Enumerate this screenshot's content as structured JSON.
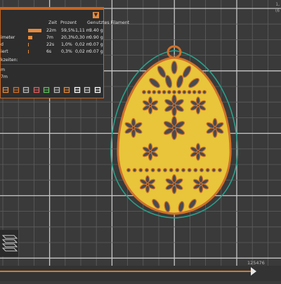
{
  "table": {
    "headers": {
      "time": "Zeit",
      "percent": "Prozent",
      "filament": "Genutztes Filament"
    },
    "rows": [
      {
        "label": "",
        "time": "22m",
        "percent": "59,5%",
        "fraction": 0.595,
        "length": "1,11 m",
        "weight": "3.40 g",
        "color": "#e58a3c"
      },
      {
        "label": "imeter",
        "time": "7m",
        "percent": "20,3%",
        "fraction": 0.203,
        "length": "0,30 m",
        "weight": "0.90 g",
        "color": "#e58a3c"
      },
      {
        "label": "d",
        "time": "22s",
        "percent": "1,0%",
        "fraction": 0.01,
        "length": "0,02 m",
        "weight": "0.07 g",
        "color": "#e58a3c"
      },
      {
        "label": "iert",
        "time": "6s",
        "percent": "0,3%",
        "fraction": 0.003,
        "length": "0,02 m",
        "weight": "0.07 g",
        "color": "#e58a3c"
      }
    ],
    "section_label": "kzeiten:",
    "time_rows": [
      "m",
      "7m"
    ]
  },
  "slider": {
    "value": "125476",
    "fraction": 0.91
  },
  "corner": {
    "line1": "1,",
    "line2": "(6"
  },
  "colors": {
    "accent": "#e58a3c",
    "panel_border": "#c9651f",
    "bed_background": "#3a3a3a",
    "grid": "#5e5e5e",
    "egg_fill": "#e8c53a",
    "egg_outline": "#d0702a",
    "egg_holes": "#4a4a4e",
    "skirt": "#2aa08a"
  },
  "icons": [
    "layers-icon",
    "infill-icon",
    "retraction-icon",
    "seam-icon",
    "support-icon",
    "shell-icon",
    "tool-change-icon",
    "model-icon",
    "cube-icon",
    "download-icon"
  ]
}
